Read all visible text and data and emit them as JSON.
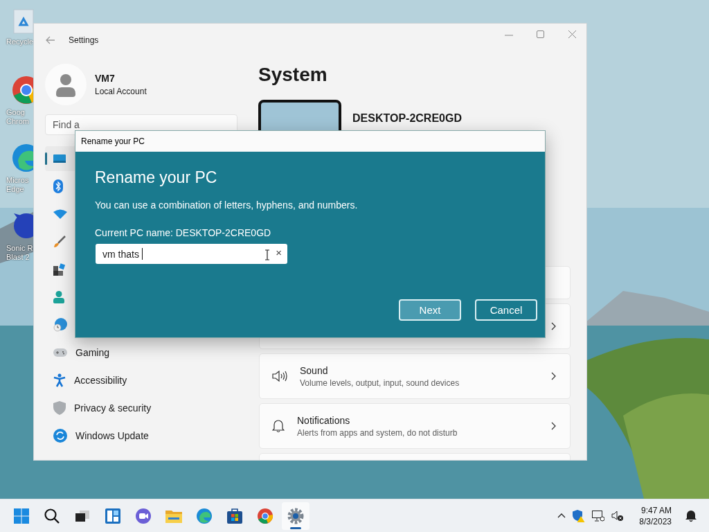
{
  "desktop_icons": [
    {
      "kind": "recycle",
      "lines": [
        "Recycle"
      ]
    },
    {
      "kind": "chrome",
      "lines": [
        "Goog",
        "Chrom"
      ]
    },
    {
      "kind": "edge",
      "lines": [
        "Micros",
        "Edge"
      ]
    },
    {
      "kind": "game",
      "lines": [
        "Sonic R",
        "Blast 2"
      ]
    }
  ],
  "settings": {
    "title": "Settings",
    "profile": {
      "name": "VM7",
      "account": "Local Account"
    },
    "search": {
      "placeholder": "Find a"
    },
    "sidebar": [
      {
        "kind": "display",
        "selected": true
      },
      {
        "kind": "bluetooth",
        "selected": false
      },
      {
        "kind": "wifi",
        "selected": false
      },
      {
        "kind": "brush",
        "selected": false
      },
      {
        "kind": "apps",
        "selected": false
      },
      {
        "kind": "person",
        "selected": false
      },
      {
        "kind": "globe",
        "selected": false
      },
      {
        "kind": "gamepad",
        "label": "Gaming",
        "selected": false
      },
      {
        "kind": "accessibility",
        "label": "Accessibility",
        "selected": false
      },
      {
        "kind": "shield",
        "label": "Privacy & security",
        "selected": false
      },
      {
        "kind": "update",
        "label": "Windows Update",
        "selected": false
      }
    ],
    "heading": "System",
    "device_name": "DESKTOP-2CRE0GD",
    "cards": [
      {
        "kind": "covered",
        "chevron": false
      },
      {
        "kind": "covered",
        "chevron": true
      },
      {
        "kind": "speaker",
        "title": "Sound",
        "subtitle": "Volume levels, output, input, sound devices",
        "chevron": true
      },
      {
        "kind": "bell",
        "title": "Notifications",
        "subtitle": "Alerts from apps and system, do not disturb",
        "chevron": true
      },
      {
        "kind": "covered"
      }
    ]
  },
  "dialog": {
    "window_title": "Rename your PC",
    "heading": "Rename your PC",
    "text": "You can use a combination of letters, hyphens, and numbers.",
    "current_name": "Current PC name: DESKTOP-2CRE0GD",
    "field": {
      "value": "vm thats ",
      "clear": "×"
    },
    "buttons": [
      {
        "label": "Next",
        "kind": "primary"
      },
      {
        "label": "Cancel",
        "kind": "secondary"
      }
    ]
  },
  "taskbar": {
    "apps": [
      {
        "kind": "start",
        "active": false
      },
      {
        "kind": "search",
        "active": false
      },
      {
        "kind": "taskview",
        "active": false
      },
      {
        "kind": "widgets",
        "active": false
      },
      {
        "kind": "chat",
        "active": false
      },
      {
        "kind": "folder",
        "active": false
      },
      {
        "kind": "edge",
        "active": false
      },
      {
        "kind": "store",
        "active": false
      },
      {
        "kind": "chrome",
        "active": false
      },
      {
        "kind": "settings",
        "active": true
      }
    ],
    "time": "9:47 AM",
    "date": "8/3/2023"
  }
}
